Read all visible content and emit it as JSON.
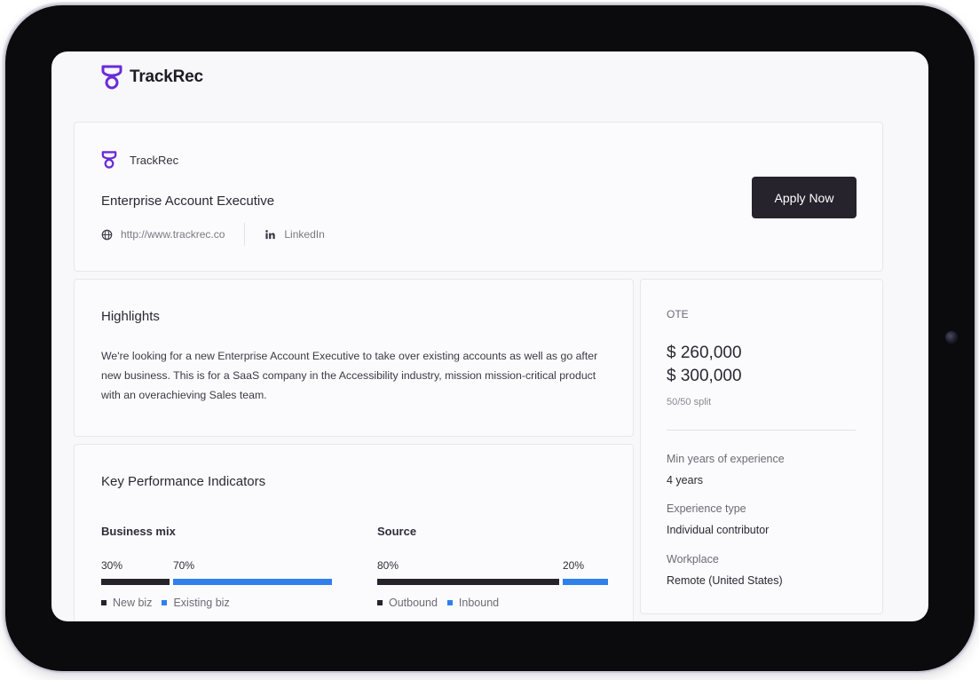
{
  "brand": {
    "name": "TrackRec",
    "accent_color": "#6b2bd9",
    "logo_icon": "trackrec-logo-icon"
  },
  "company": {
    "name": "TrackRec",
    "job_title": "Enterprise Account Executive",
    "website": "http://www.trackrec.co",
    "website_icon": "globe-icon",
    "linkedin": "LinkedIn",
    "linkedin_icon": "linkedin-icon",
    "apply_label": "Apply Now"
  },
  "highlights": {
    "title": "Highlights",
    "body": "We're looking for a new Enterprise Account Executive to take over existing accounts as well as go after new business. This is for a SaaS company in the Accessibility industry, mission mission-critical product with an overachieving Sales team."
  },
  "kpi": {
    "title": "Key Performance Indicators",
    "business_mix": {
      "label": "Business mix",
      "first_pct": "30%",
      "second_pct": "70%",
      "first_value": 30,
      "second_value": 70,
      "first_legend": "New biz",
      "second_legend": "Existing biz"
    },
    "source": {
      "label": "Source",
      "first_pct": "80%",
      "second_pct": "20%",
      "first_value": 80,
      "second_value": 20,
      "first_legend": "Outbound",
      "second_legend": "Inbound"
    },
    "colors": {
      "dark": "#26232d",
      "blue": "#2f80ed"
    }
  },
  "compensation": {
    "ote_label": "OTE",
    "ote_low": "$ 260,000",
    "ote_high": "$ 300,000",
    "split": "50/50 split"
  },
  "requirements": {
    "min_years_label": "Min years of experience",
    "min_years_value": "4 years",
    "experience_type_label": "Experience type",
    "experience_type_value": "Individual contributor",
    "workplace_label": "Workplace",
    "workplace_value": "Remote (United States)"
  }
}
